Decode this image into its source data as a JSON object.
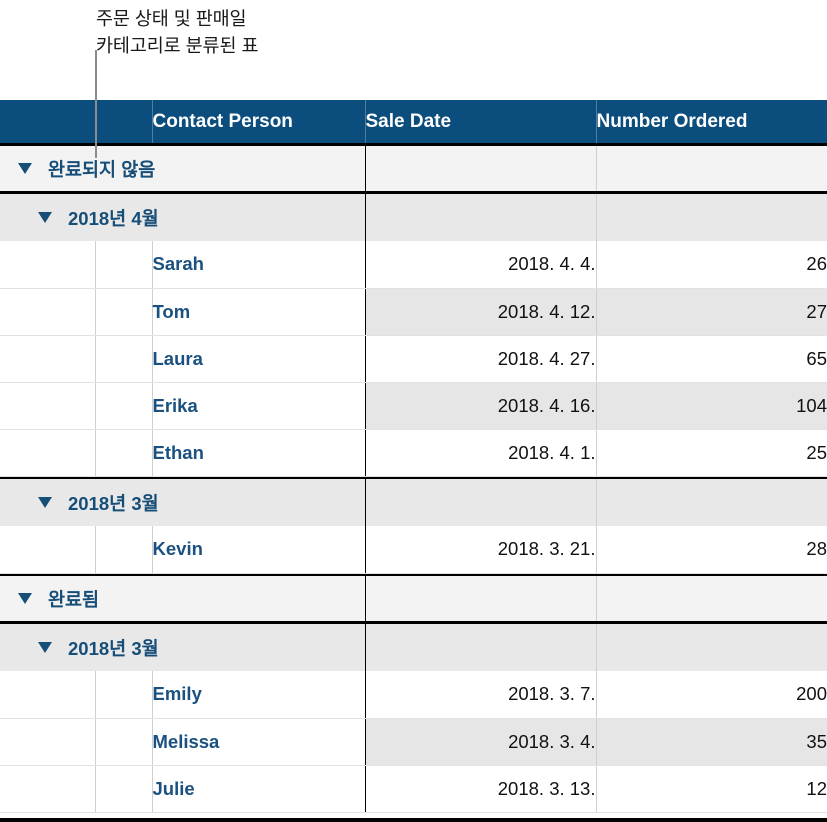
{
  "callout": {
    "text": "주문 상태 및 판매일\n카테고리로 분류된 표",
    "line_color": "#8c8c8c"
  },
  "theme": {
    "header_bg": "#0b4d7d",
    "header_text": "#ffffff",
    "link_blue": "#1a5180",
    "group_blue": "#174e78",
    "group1_bg": "#f3f3f3",
    "group2_bg": "#e8e8e8",
    "stripe_bg": "#e6e6e6",
    "rule_color": "#000000"
  },
  "table": {
    "columns": [
      {
        "key": "blank1",
        "label": ""
      },
      {
        "key": "blank2",
        "label": ""
      },
      {
        "key": "contact",
        "label": "Contact Person"
      },
      {
        "key": "sale_date",
        "label": "Sale Date"
      },
      {
        "key": "number_ordered",
        "label": "Number Ordered"
      }
    ],
    "groups": [
      {
        "label": "완료되지 않음",
        "level": 1,
        "expanded": true,
        "subgroups": [
          {
            "label": "2018년 4월",
            "level": 2,
            "expanded": true,
            "rows": [
              {
                "contact": "Sarah",
                "sale_date": "2018. 4. 4.",
                "number_ordered": "26"
              },
              {
                "contact": "Tom",
                "sale_date": "2018. 4. 12.",
                "number_ordered": "27"
              },
              {
                "contact": "Laura",
                "sale_date": "2018. 4. 27.",
                "number_ordered": "65"
              },
              {
                "contact": "Erika",
                "sale_date": "2018. 4. 16.",
                "number_ordered": "104"
              },
              {
                "contact": "Ethan",
                "sale_date": "2018. 4. 1.",
                "number_ordered": "25"
              }
            ]
          },
          {
            "label": "2018년 3월",
            "level": 2,
            "expanded": true,
            "rows": [
              {
                "contact": "Kevin",
                "sale_date": "2018. 3. 21.",
                "number_ordered": "28"
              }
            ]
          }
        ]
      },
      {
        "label": "완료됨",
        "level": 1,
        "expanded": true,
        "subgroups": [
          {
            "label": "2018년 3월",
            "level": 2,
            "expanded": true,
            "rows": [
              {
                "contact": "Emily",
                "sale_date": "2018. 3. 7.",
                "number_ordered": "200"
              },
              {
                "contact": "Melissa",
                "sale_date": "2018. 3. 4.",
                "number_ordered": "35"
              },
              {
                "contact": "Julie",
                "sale_date": "2018. 3. 13.",
                "number_ordered": "12"
              }
            ]
          }
        ]
      }
    ]
  }
}
